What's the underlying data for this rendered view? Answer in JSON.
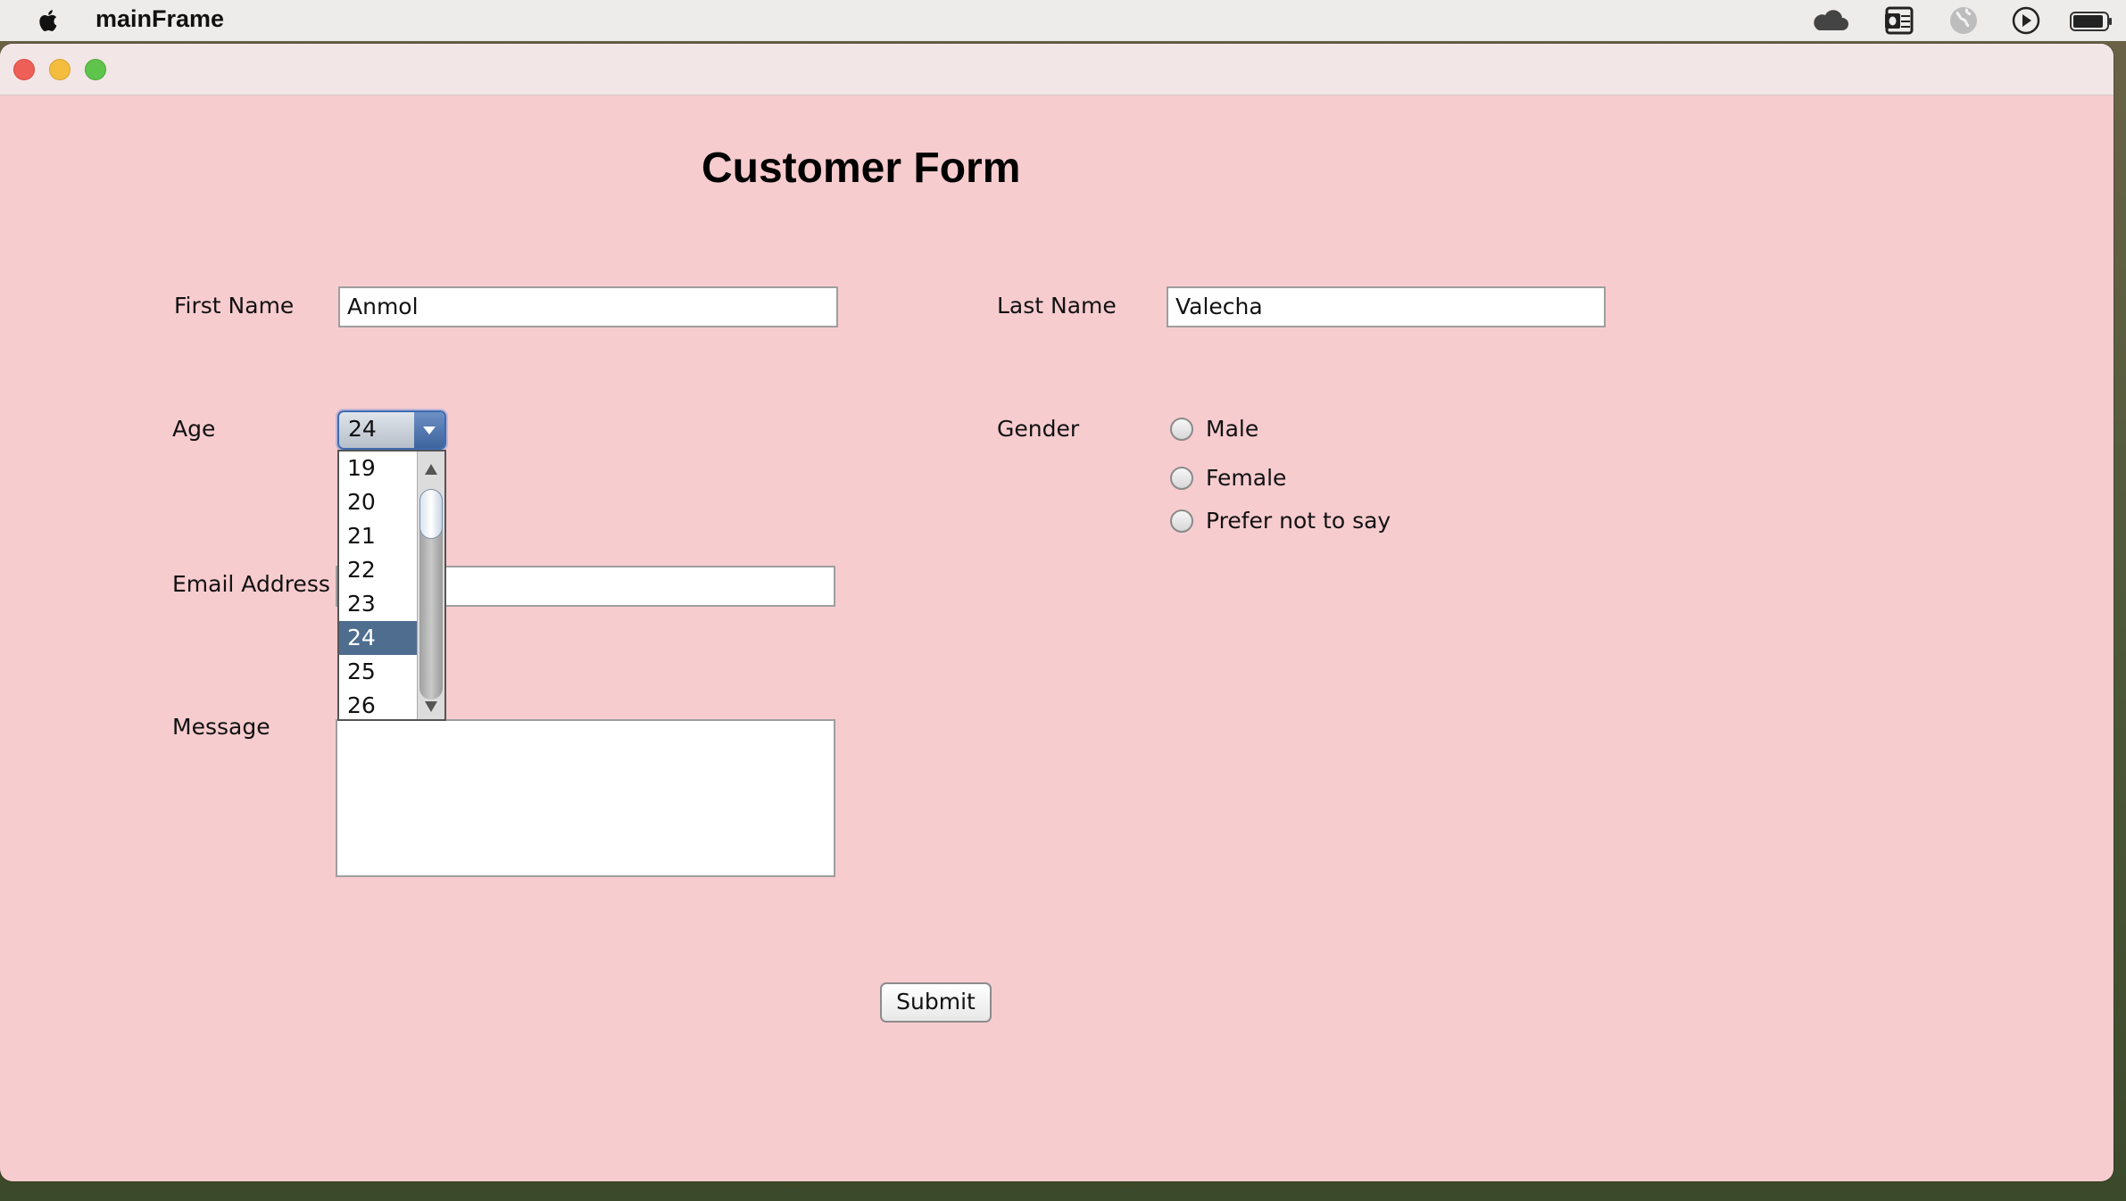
{
  "menubar": {
    "app_name": "mainFrame",
    "icons": [
      "apple-icon",
      "cloud-icon",
      "outlook-icon",
      "globe-icon",
      "play-icon",
      "battery-icon"
    ]
  },
  "form": {
    "title": "Customer Form",
    "first_name_label": "First Name",
    "first_name_value": "Anmol",
    "last_name_label": "Last Name",
    "last_name_value": "Valecha",
    "age_label": "Age",
    "age_value": "24",
    "age_options": [
      "19",
      "20",
      "21",
      "22",
      "23",
      "24",
      "25",
      "26"
    ],
    "age_selected": "24",
    "gender_label": "Gender",
    "gender_options": [
      "Male",
      "Female",
      "Prefer not to say"
    ],
    "email_label": "Email Address",
    "email_value": "",
    "message_label": "Message",
    "message_value": "",
    "submit_label": "Submit"
  },
  "colors": {
    "window_bg": "#f7cccf",
    "accent": "#3d6bb0",
    "selection": "#4f6d8f"
  }
}
